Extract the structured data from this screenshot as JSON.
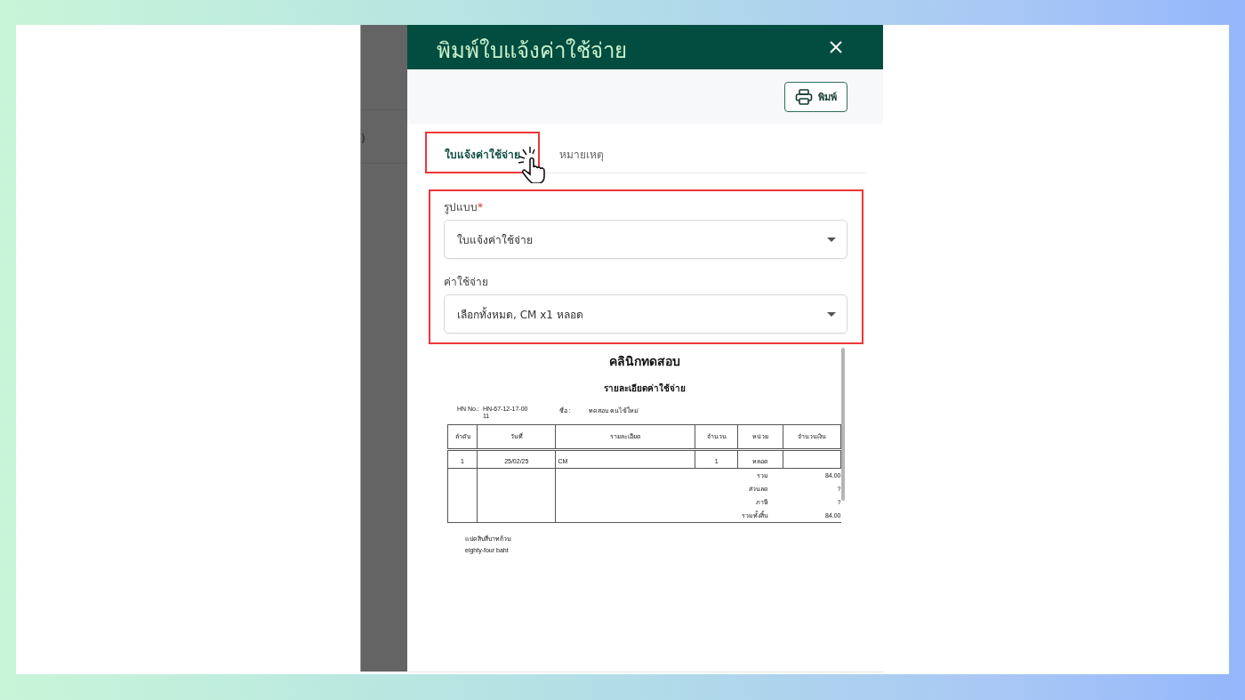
{
  "backdrop": {
    "fragment": ")"
  },
  "dialog": {
    "title": "พิมพ์ใบแจ้งค่าใช้จ่าย",
    "print_button": "พิมพ์"
  },
  "tabs": [
    {
      "label": "ใบแจ้งค่าใช้จ่าย",
      "selected": true,
      "highlighted": true
    },
    {
      "label": "หมายเหตุ",
      "selected": false,
      "highlighted": false
    }
  ],
  "form": {
    "highlighted": true,
    "fields": [
      {
        "label": "รูปแบบ",
        "required_mark": "*",
        "value": "ใบแจ้งค่าใช้จ่าย"
      },
      {
        "label": "ค่าใช้จ่าย",
        "value": "เลือกทั้งหมด, CM x1 หลอด"
      }
    ]
  },
  "preview": {
    "clinic": "คลินิกทดสอบ",
    "heading": "รายละเอียดค่าใช้จ่าย",
    "hn_label": "HN No.:",
    "hn_value": "HN-67-12-17-0011",
    "name_label": "ชื่อ :",
    "name_value": "ทดสอบ คนไข้ใหม่",
    "columns": [
      "ลำดับ",
      "วันที่",
      "รายละเอียด",
      "จำนวน",
      "หน่วย",
      "จำนวนเงิน"
    ],
    "rows": [
      {
        "no": "1",
        "date": "25/02/25",
        "detail": "CM",
        "qty": "1",
        "unit": "หลอด"
      }
    ],
    "totals": [
      {
        "label": "รวม",
        "value": "84.00"
      },
      {
        "label": "ส่วนลด",
        "value": "?"
      },
      {
        "label": "ภาษี",
        "value": "?"
      },
      {
        "label": "รวมทั้งสิ้น",
        "value": "84.00"
      }
    ],
    "amount_thai": "แปดสิบสี่บาทถ้วน",
    "amount_english": "eighty-four baht"
  }
}
